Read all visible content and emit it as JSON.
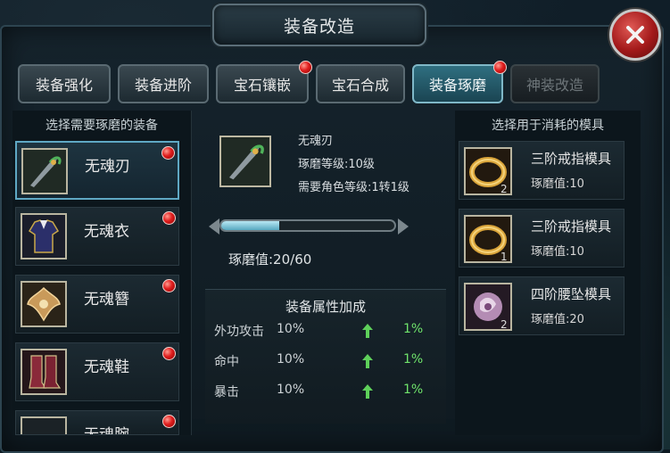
{
  "title": "装备改造",
  "tabs": [
    {
      "label": "装备强化",
      "badge": false,
      "state": "normal"
    },
    {
      "label": "装备进阶",
      "badge": false,
      "state": "normal"
    },
    {
      "label": "宝石镶嵌",
      "badge": true,
      "state": "normal"
    },
    {
      "label": "宝石合成",
      "badge": false,
      "state": "normal"
    },
    {
      "label": "装备琢磨",
      "badge": true,
      "state": "active"
    },
    {
      "label": "神装改造",
      "badge": false,
      "state": "disabled"
    }
  ],
  "left_panel": {
    "title": "选择需要琢磨的装备",
    "items": [
      {
        "name": "无魂刃",
        "icon": "sword-icon",
        "selected": true,
        "badge": true
      },
      {
        "name": "无魂衣",
        "icon": "armor-icon",
        "selected": false,
        "badge": true
      },
      {
        "name": "无魂簪",
        "icon": "hairpin-icon",
        "selected": false,
        "badge": true
      },
      {
        "name": "无魂鞋",
        "icon": "boots-icon",
        "selected": false,
        "badge": true
      },
      {
        "name": "无魂腕",
        "icon": "bracer-icon",
        "selected": false,
        "badge": true
      }
    ]
  },
  "selected_item": {
    "name": "无魂刃",
    "polish_level": "琢磨等级:10级",
    "required_level": "需要角色等级:1转1级",
    "progress": {
      "current": 20,
      "max": 60,
      "fraction": 0.333
    },
    "polish_value_text": "琢磨值:20/60"
  },
  "attributes": {
    "title": "装备属性加成",
    "rows": [
      {
        "name": "外功攻击",
        "value": "10%",
        "bonus": "1%"
      },
      {
        "name": "命中",
        "value": "10%",
        "bonus": "1%"
      },
      {
        "name": "暴击",
        "value": "10%",
        "bonus": "1%"
      }
    ]
  },
  "right_panel": {
    "title": "选择用于消耗的模具",
    "molds": [
      {
        "name": "三阶戒指模具",
        "value": "琢磨值:10",
        "count": "2",
        "icon": "ring-mold-icon"
      },
      {
        "name": "三阶戒指模具",
        "value": "琢磨值:10",
        "count": "1",
        "icon": "ring-mold-icon"
      },
      {
        "name": "四阶腰坠模具",
        "value": "琢磨值:20",
        "count": "2",
        "icon": "pendant-mold-icon"
      }
    ]
  },
  "colors": {
    "accent": "#5fa8c4",
    "badge": "#e01d1d",
    "bonus": "#6fe36b"
  }
}
